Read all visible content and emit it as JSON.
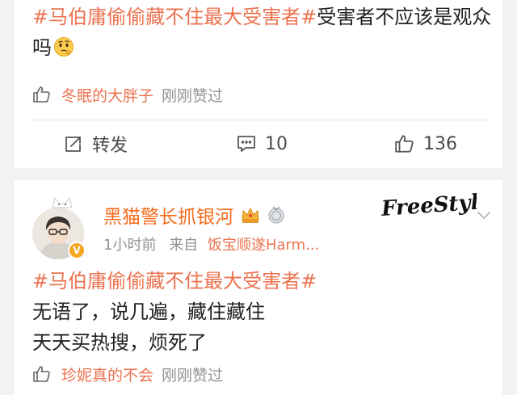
{
  "post1": {
    "text_topic": "#马伯庸偷偷藏不住最大受害者#",
    "text_rest": "受害者不应该是观众吗",
    "emoji_icon": "thinking-face-icon",
    "liked_by_user": "冬眠的大胖子",
    "liked_by_suffix": "刚刚赞过",
    "actions": {
      "repost_label": "转发",
      "comment_count": "10",
      "like_count": "136"
    }
  },
  "post2": {
    "username": "黑猫警长抓银河",
    "verified_badge": "V",
    "time": "1小时前",
    "from_label": "来自",
    "source": "饭宝顺遂Harm...",
    "freestyle_watermark": "FreeStyle",
    "text_topic": "#马伯庸偷偷藏不住最大受害者#",
    "line2": "无语了，说几遍，藏住藏住",
    "line3": "天天买热搜，烦死了",
    "liked_by_user": "珍妮真的不会",
    "liked_by_suffix": "刚刚赞过"
  },
  "colors": {
    "topic": "#eb7350",
    "username": "#f76b1c",
    "meta_gray": "#939393",
    "background": "#f2f2f2"
  }
}
